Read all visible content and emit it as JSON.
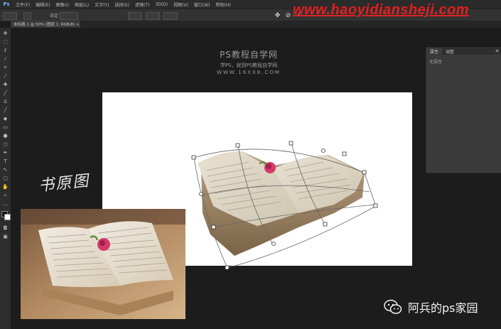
{
  "app": {
    "logo": "Ps"
  },
  "menu": [
    "文件(F)",
    "编辑(E)",
    "图像(I)",
    "图层(L)",
    "文字(Y)",
    "选择(S)",
    "滤镜(T)",
    "3D(D)",
    "视图(V)",
    "窗口(W)",
    "帮助(H)"
  ],
  "options": {
    "mode": "自定"
  },
  "document_tab": {
    "label": "未标题-1 @ 50% (图层 1, RGB/8) ×"
  },
  "panel": {
    "tabs": [
      "属性",
      "调整"
    ],
    "body": "无属性"
  },
  "watermark": {
    "url": "www.haoyidiansheji.com",
    "ps_title": "PS教程自学网",
    "ps_subtitle": "学PS，就到PS教程自学网",
    "ps_site": "WWW.16XX8.COM"
  },
  "caption": {
    "original_label": "书原图"
  },
  "wechat": {
    "name": "阿兵的ps家园"
  },
  "colors": {
    "accent_url": "#e02020",
    "ps_blue": "#6fb6ff",
    "rose": "#d23a6a"
  },
  "icons": [
    "move-icon",
    "marquee-icon",
    "lasso-icon",
    "magic-wand-icon",
    "crop-icon",
    "eyedropper-icon",
    "healing-icon",
    "brush-icon",
    "clone-stamp-icon",
    "history-brush-icon",
    "eraser-icon",
    "gradient-icon",
    "blur-icon",
    "dodge-icon",
    "pen-icon",
    "type-icon",
    "path-select-icon",
    "shape-icon",
    "hand-icon",
    "zoom-icon"
  ]
}
